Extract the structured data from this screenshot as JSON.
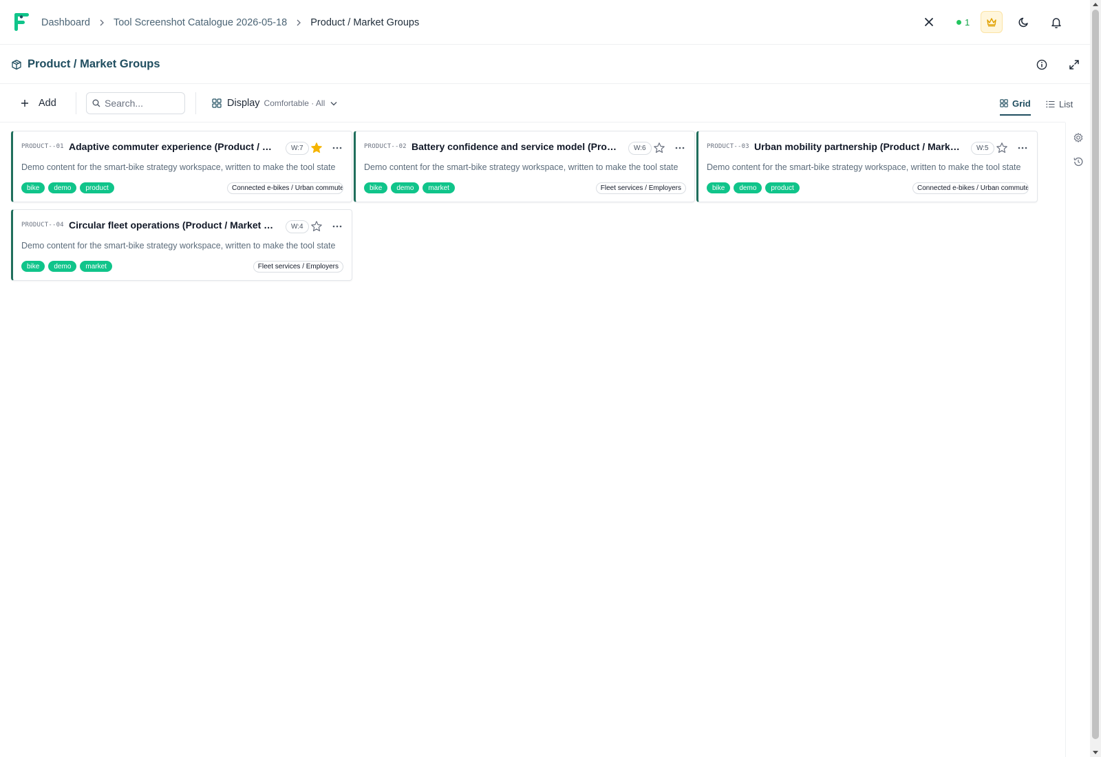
{
  "breadcrumb": {
    "items": [
      {
        "label": "Dashboard"
      },
      {
        "label": "Tool Screenshot Catalogue 2026-05-18"
      },
      {
        "label": "Product / Market Groups"
      }
    ]
  },
  "top_actions": {
    "presence_count": "1",
    "icons": [
      "close-icon",
      "crown-icon",
      "moon-icon",
      "bell-icon"
    ]
  },
  "page": {
    "title": "Product / Market Groups"
  },
  "toolbar": {
    "add_label": "Add",
    "search_placeholder": "Search...",
    "display_label": "Display",
    "display_sub": "Comfortable · All",
    "views": [
      {
        "label": "Grid",
        "active": true
      },
      {
        "label": "List",
        "active": false
      }
    ]
  },
  "colors": {
    "accent": "#1f4d5f",
    "tag": "#10c48a",
    "card_border": "#1f6e5c",
    "star_active": "#f5b400"
  },
  "cards": [
    {
      "code": "PRODUCT--01",
      "title": "Adaptive commuter experience (Product / Market Groups)",
      "weight": "W:7",
      "starred": true,
      "description": "Demo content for the smart-bike strategy workspace, written to make the tool state visible in catalogue screenshots.",
      "tags": [
        "bike",
        "demo",
        "product"
      ],
      "group": "Connected e-bikes / Urban commuters"
    },
    {
      "code": "PRODUCT--02",
      "title": "Battery confidence and service model (Product / Market Groups)",
      "weight": "W:6",
      "starred": false,
      "description": "Demo content for the smart-bike strategy workspace, written to make the tool state visible in catalogue screenshots.",
      "tags": [
        "bike",
        "demo",
        "market"
      ],
      "group": "Fleet services / Employers"
    },
    {
      "code": "PRODUCT--03",
      "title": "Urban mobility partnership (Product / Market Groups)",
      "weight": "W:5",
      "starred": false,
      "description": "Demo content for the smart-bike strategy workspace, written to make the tool state visible in catalogue screenshots.",
      "tags": [
        "bike",
        "demo",
        "product"
      ],
      "group": "Connected e-bikes / Urban commuters"
    },
    {
      "code": "PRODUCT--04",
      "title": "Circular fleet operations (Product / Market Groups)",
      "weight": "W:4",
      "starred": false,
      "description": "Demo content for the smart-bike strategy workspace, written to make the tool state visible in catalogue screenshots.",
      "tags": [
        "bike",
        "demo",
        "market"
      ],
      "group": "Fleet services / Employers"
    }
  ]
}
